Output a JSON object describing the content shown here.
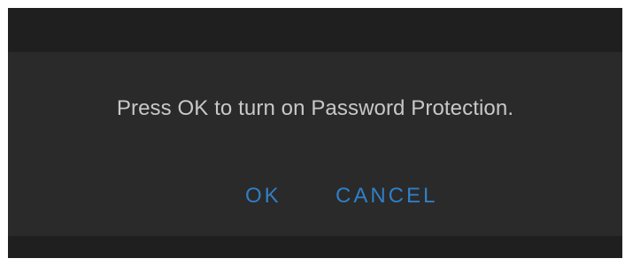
{
  "dialog": {
    "message": "Press OK to turn on Password Protection.",
    "ok_label": "OK",
    "cancel_label": "CANCEL"
  },
  "colors": {
    "background": "#1c1c1c",
    "dialog_background": "#2a2a2a",
    "message_text": "#c8c8c8",
    "button_text": "#2f7fc7"
  }
}
